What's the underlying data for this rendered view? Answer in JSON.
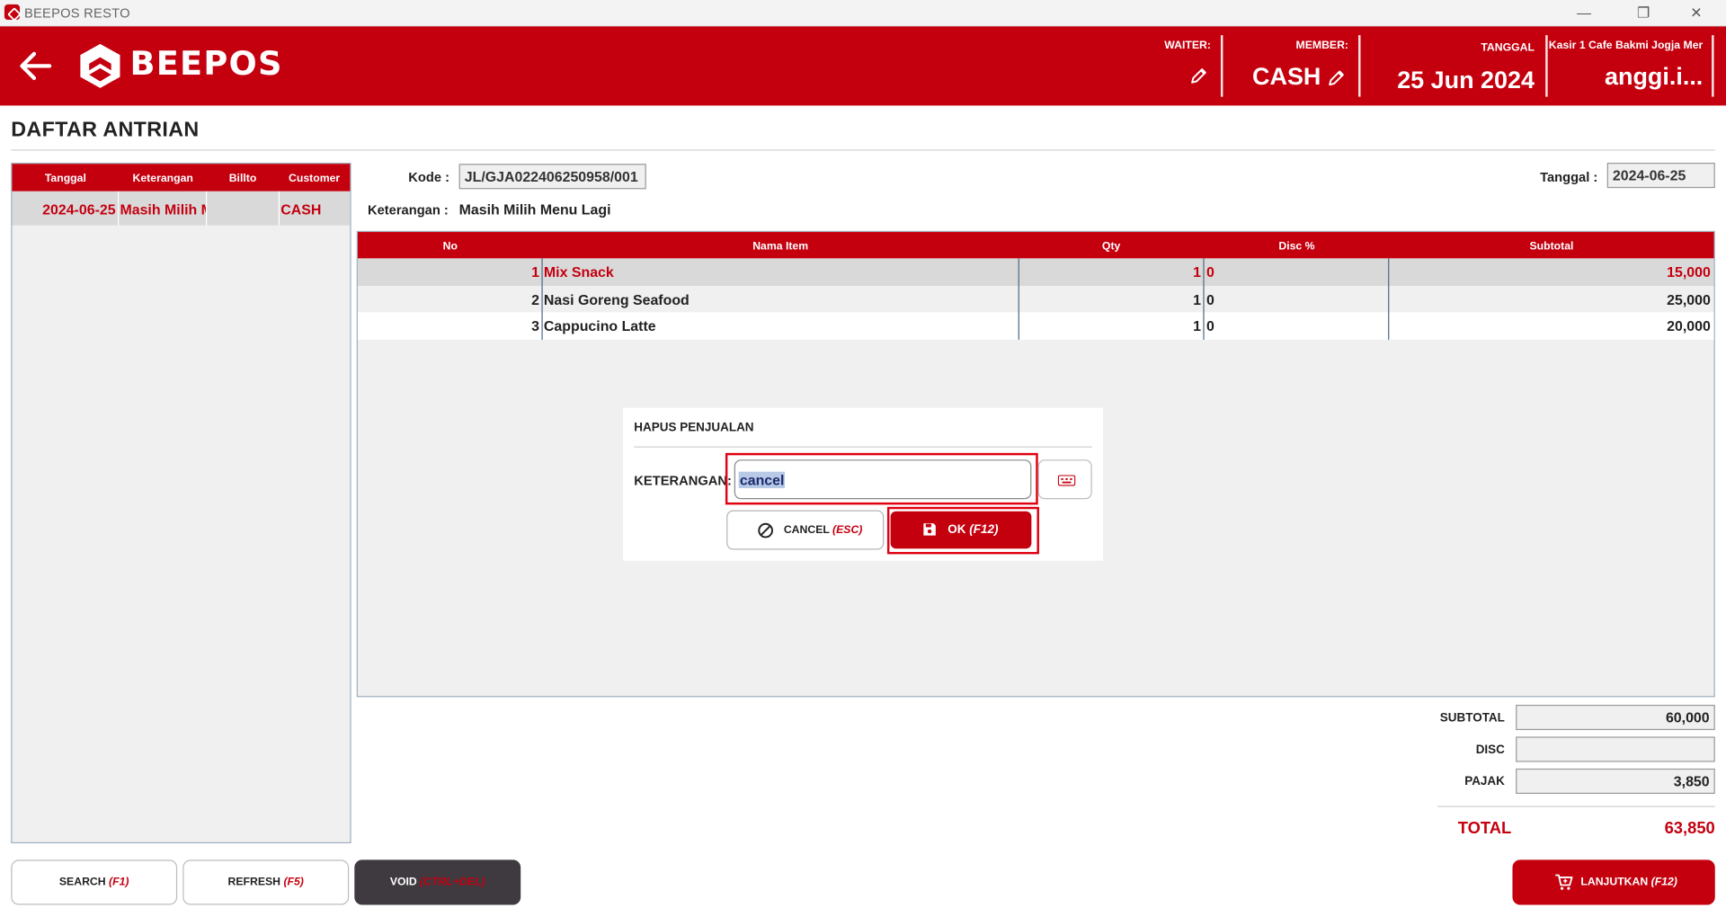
{
  "window": {
    "title": "BEEPOS RESTO",
    "minimize": "—",
    "restore": "❐",
    "close": "✕"
  },
  "header": {
    "brand": "BEEPOS",
    "waiter_label": "WAITER:",
    "member_label": "MEMBER:",
    "member_value": "CASH",
    "date_label": "TANGGAL",
    "date_value": "25 Jun 2024",
    "cashier_label": "Kasir 1 Cafe Bakmi Jogja Mer",
    "user_value": "anggi.i..."
  },
  "page_title": "DAFTAR ANTRIAN",
  "queue": {
    "columns": [
      "Tanggal",
      "Keterangan",
      "Billto",
      "Customer"
    ],
    "rows": [
      {
        "tanggal": "2024-06-25",
        "keterangan": "Masih Milih Menu Lagi",
        "billto": "",
        "customer": "CASH"
      }
    ]
  },
  "form": {
    "kode_label": "Kode :",
    "kode_value": "JL/GJA022406250958/001",
    "keterangan_label": "Keterangan :",
    "keterangan_value": "Masih Milih Menu Lagi",
    "tanggal_label": "Tanggal :",
    "tanggal_value": "2024-06-25"
  },
  "items": {
    "columns": [
      "No",
      "Nama Item",
      "Qty",
      "Disc %",
      "Subtotal"
    ],
    "rows": [
      {
        "no": "1",
        "name": "Mix Snack",
        "qty": "1",
        "disc": "0",
        "subtotal": "15,000"
      },
      {
        "no": "2",
        "name": "Nasi Goreng Seafood",
        "qty": "1",
        "disc": "0",
        "subtotal": "25,000"
      },
      {
        "no": "3",
        "name": "Cappucino Latte",
        "qty": "1",
        "disc": "0",
        "subtotal": "20,000"
      }
    ]
  },
  "dialog": {
    "title": "HAPUS PENJUALAN",
    "keterangan_label": "KETERANGAN:",
    "keterangan_value": "cancel",
    "cancel_label": "CANCEL",
    "cancel_key": "(ESC)",
    "ok_label": "OK",
    "ok_key": "(F12)"
  },
  "totals": {
    "subtotal_label": "SUBTOTAL",
    "subtotal_value": "60,000",
    "disc_label": "DISC",
    "disc_value": "",
    "pajak_label": "PAJAK",
    "pajak_value": "3,850",
    "total_label": "TOTAL",
    "total_value": "63,850"
  },
  "buttons": {
    "search_label": "SEARCH",
    "search_key": "(F1)",
    "refresh_label": "REFRESH",
    "refresh_key": "(F5)",
    "void_label": "VOID",
    "void_key": "(CTRL+DEL)",
    "lanjutkan_label": "LANJUTKAN",
    "lanjutkan_key": "(F12)"
  },
  "colors": {
    "brand_red": "#c4000f",
    "row_selected": "#d9d9d9",
    "void_dark": "#3f3a40"
  }
}
